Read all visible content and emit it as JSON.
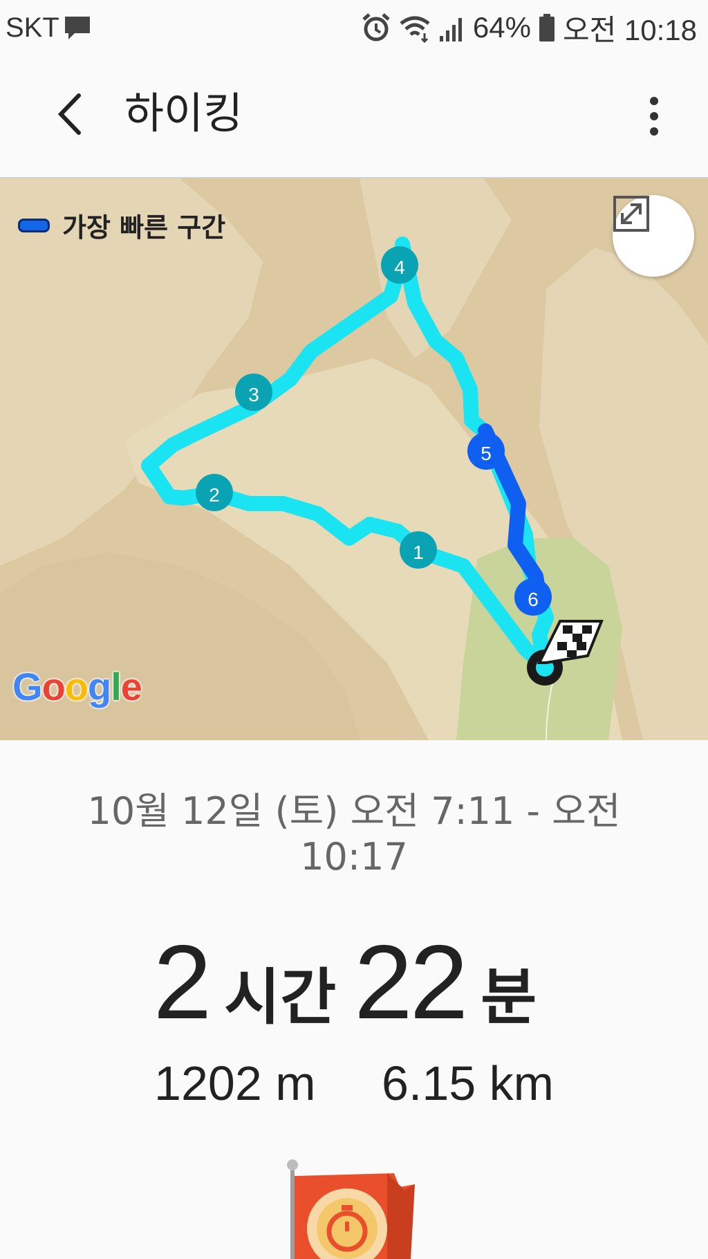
{
  "status_bar": {
    "carrier": "SKT",
    "battery": "64%",
    "time": "오전 10:18",
    "icons": [
      "message-icon",
      "alarm-icon",
      "wifi-icon",
      "signal-icon",
      "battery-icon"
    ]
  },
  "app_bar": {
    "title": "하이킹",
    "back_icon": "back-arrow-icon",
    "more_icon": "more-vert-icon"
  },
  "map": {
    "legend_label": "가장 빠른 구간",
    "legend_color": "#1565e8",
    "route_color": "#1ae4f2",
    "fastest_color": "#0f5ff0",
    "marker_color": "#0aa3b4",
    "expand_icon": "expand-icon",
    "attribution": "Google",
    "markers": [
      "1",
      "2",
      "3",
      "4",
      "5",
      "6"
    ],
    "end_icon": "finish-flag-icon"
  },
  "summary": {
    "date_range": "10월 12일 (토) 오전 7:11 - 오전 10:17",
    "hours": "2",
    "hours_unit": "시간",
    "minutes": "22",
    "minutes_unit": "분",
    "elevation": "1202 m",
    "distance": "6.15 km"
  },
  "badge_icon": "stopwatch-flag-icon"
}
